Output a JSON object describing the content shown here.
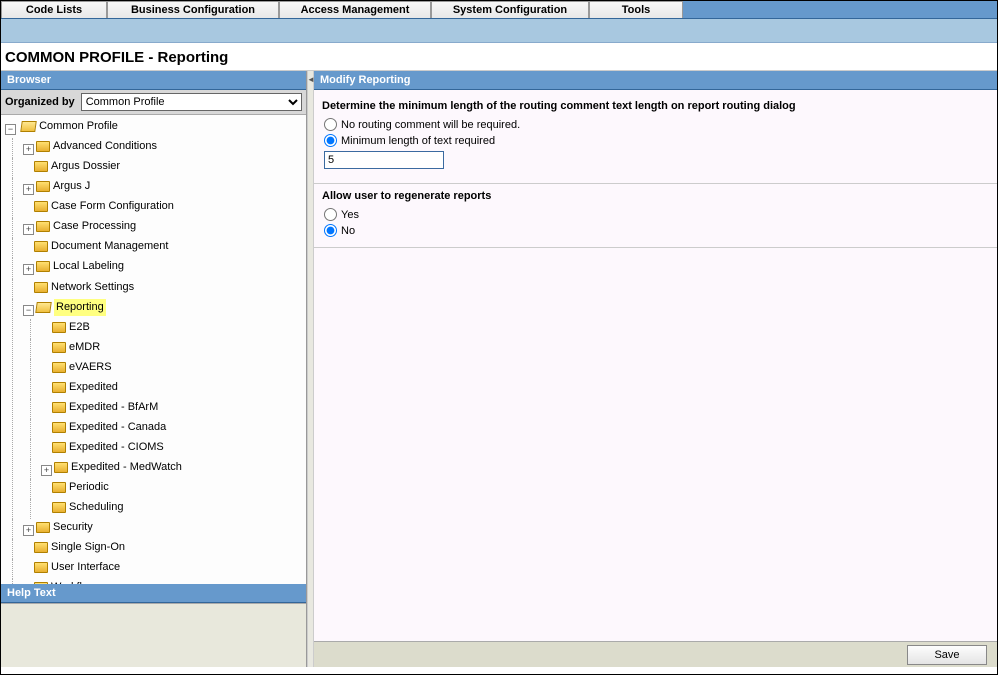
{
  "menu": {
    "items": [
      "Code Lists",
      "Business Configuration",
      "Access Management",
      "System Configuration",
      "Tools"
    ]
  },
  "page_title": "COMMON PROFILE - Reporting",
  "browser": {
    "header": "Browser",
    "organized_by_label": "Organized by",
    "organized_by_value": "Common Profile",
    "help_header": "Help Text",
    "tree": {
      "root": "Common Profile",
      "children": [
        {
          "label": "Advanced Conditions",
          "exp": "+"
        },
        {
          "label": "Argus Dossier",
          "exp": ""
        },
        {
          "label": "Argus J",
          "exp": "+"
        },
        {
          "label": "Case Form Configuration",
          "exp": ""
        },
        {
          "label": "Case Processing",
          "exp": "+"
        },
        {
          "label": "Document Management",
          "exp": ""
        },
        {
          "label": "Local Labeling",
          "exp": "+"
        },
        {
          "label": "Network Settings",
          "exp": ""
        },
        {
          "label": "Reporting",
          "exp": "-",
          "selected": true,
          "children": [
            {
              "label": "E2B"
            },
            {
              "label": "eMDR"
            },
            {
              "label": "eVAERS"
            },
            {
              "label": "Expedited"
            },
            {
              "label": "Expedited - BfArM"
            },
            {
              "label": "Expedited - Canada"
            },
            {
              "label": "Expedited - CIOMS"
            },
            {
              "label": "Expedited - MedWatch",
              "exp": "+"
            },
            {
              "label": "Periodic"
            },
            {
              "label": "Scheduling"
            }
          ]
        },
        {
          "label": "Security",
          "exp": "+"
        },
        {
          "label": "Single Sign-On",
          "exp": ""
        },
        {
          "label": "User Interface",
          "exp": ""
        },
        {
          "label": "Workflow",
          "exp": ""
        }
      ]
    }
  },
  "modify": {
    "header": "Modify Reporting",
    "q1_label": "Determine the minimum length of the routing comment text length on report routing dialog",
    "q1_opt1": "No routing comment will be required.",
    "q1_opt2": "Minimum length of text required",
    "q1_selected": "opt2",
    "q1_value": "5",
    "q2_label": "Allow user to regenerate reports",
    "q2_opt1": "Yes",
    "q2_opt2": "No",
    "q2_selected": "opt2",
    "save_label": "Save"
  }
}
